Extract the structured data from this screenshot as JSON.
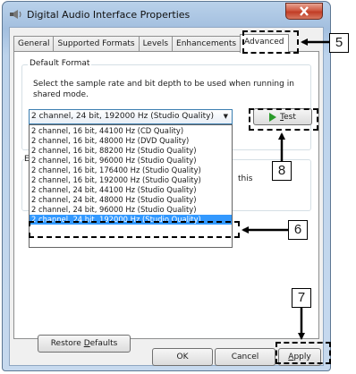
{
  "window": {
    "title": "Digital Audio Interface Properties"
  },
  "tabs": [
    {
      "label": "General",
      "active": false
    },
    {
      "label": "Supported Formats",
      "active": false
    },
    {
      "label": "Levels",
      "active": false
    },
    {
      "label": "Enhancements",
      "active": false
    },
    {
      "label": "Advanced",
      "active": true
    }
  ],
  "default_format": {
    "legend": "Default Format",
    "description": "Select the sample rate and bit depth to be used when running in shared mode.",
    "selected_value": "2 channel, 24 bit, 192000 Hz (Studio Quality)",
    "test_button": {
      "prefix": "",
      "mnemonic": "T",
      "rest": "est"
    },
    "options": [
      "2 channel, 16 bit, 44100 Hz (CD Quality)",
      "2 channel, 16 bit, 48000 Hz (DVD Quality)",
      "2 channel, 16 bit, 88200 Hz (Studio Quality)",
      "2 channel, 16 bit, 96000 Hz (Studio Quality)",
      "2 channel, 16 bit, 176400 Hz (Studio Quality)",
      "2 channel, 16 bit, 192000 Hz (Studio Quality)",
      "2 channel, 24 bit, 44100 Hz (Studio Quality)",
      "2 channel, 24 bit, 48000 Hz (Studio Quality)",
      "2 channel, 24 bit, 96000 Hz (Studio Quality)",
      "2 channel, 24 bit, 192000 Hz (Studio Quality)"
    ],
    "highlighted_index": 9
  },
  "exclusive": {
    "legend_fragment": "E",
    "text_fragment": "this"
  },
  "buttons": {
    "restore": {
      "prefix": "Restore ",
      "mnemonic": "D",
      "rest": "efaults"
    },
    "ok": "OK",
    "cancel": "Cancel",
    "apply": {
      "prefix": "",
      "mnemonic": "A",
      "rest": "pply"
    }
  },
  "callouts": {
    "advanced_tab": "5",
    "highlighted_option": "6",
    "apply_button": "7",
    "test_button": "8"
  },
  "icons": {
    "title_icon": "speaker-icon",
    "close": "close-icon",
    "combo_arrow": "chevron-down-icon",
    "test": "play-icon"
  },
  "colors": {
    "selection": "#3399ff",
    "close_button": "#c13d26",
    "test_play": "#2a9a2a"
  }
}
